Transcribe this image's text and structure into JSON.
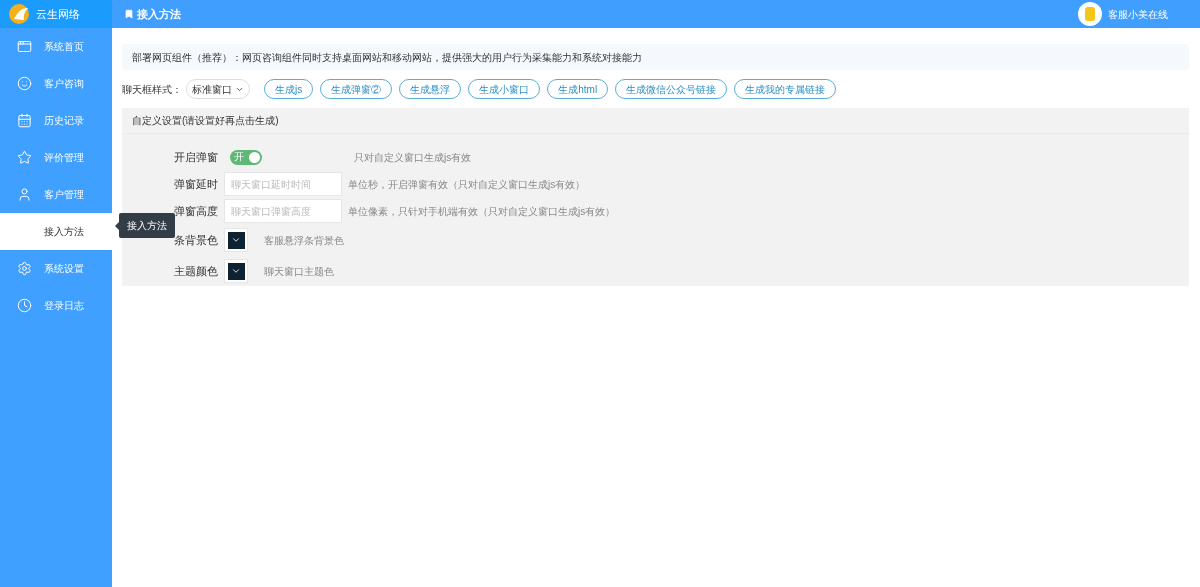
{
  "brand": "云生网络",
  "sidebar": {
    "items": [
      {
        "label": "系统首页",
        "selected": false
      },
      {
        "label": "客户咨询",
        "selected": false
      },
      {
        "label": "历史记录",
        "selected": false
      },
      {
        "label": "评价管理",
        "selected": false
      },
      {
        "label": "客户管理",
        "selected": false
      },
      {
        "label": "接入方法",
        "selected": true
      },
      {
        "label": "系统设置",
        "selected": false
      },
      {
        "label": "登录日志",
        "selected": false
      }
    ]
  },
  "tooltip": "接入方法",
  "header": {
    "title": "接入方法",
    "user": "客服小美在线"
  },
  "notice": "部署网页组件（推荐）：网页咨询组件同时支持桌面网站和移动网站，提供强大的用户行为采集能力和系统对接能力",
  "style_label": "聊天框样式：",
  "style_select": "标准窗口",
  "buttons": [
    "生成js",
    "生成弹窗②",
    "生成悬浮",
    "生成小窗口",
    "生成html",
    "生成微信公众号链接",
    "生成我的专属链接"
  ],
  "panel": {
    "title": "自定义设置(请设置好再点击生成)",
    "rows": [
      {
        "kind": "switch",
        "label": "开启弹窗",
        "on": true,
        "switch_text": "开",
        "hint": "只对自定义窗口生成js有效"
      },
      {
        "kind": "input",
        "label": "弹窗延时",
        "placeholder": "聊天窗口延时时间",
        "hint": "单位秒，开启弹窗有效（只对自定义窗口生成js有效）"
      },
      {
        "kind": "input",
        "label": "弹窗高度",
        "placeholder": "聊天窗口弹窗高度",
        "hint": "单位像素，只针对手机端有效（只对自定义窗口生成js有效）"
      },
      {
        "kind": "color",
        "label": "条背景色",
        "color": "#0f2231",
        "hint": "客服悬浮条背景色"
      },
      {
        "kind": "color",
        "label": "主题颜色",
        "color": "#0f2231",
        "hint": "聊天窗口主题色"
      }
    ]
  }
}
